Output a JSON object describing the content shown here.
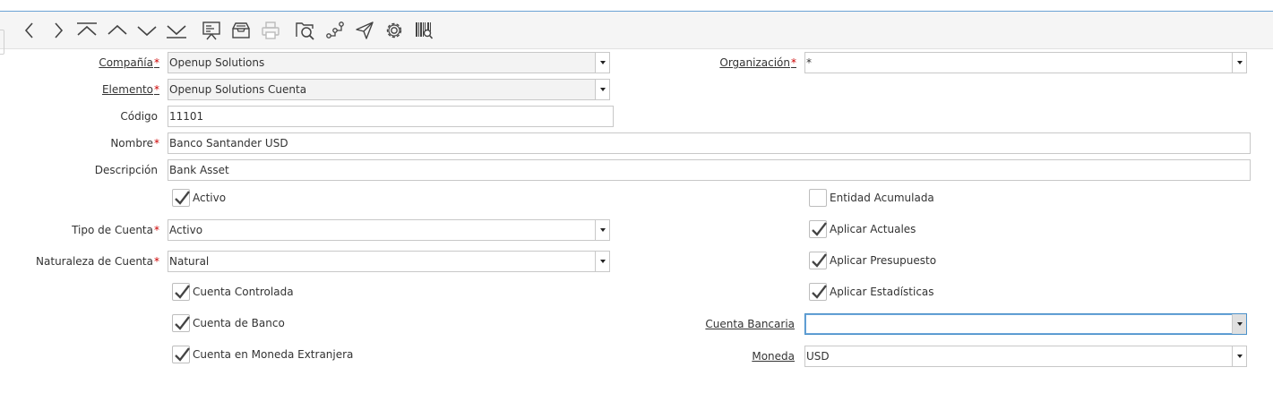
{
  "colors": {
    "accent": "#4a90c8",
    "required": "#cc0000"
  },
  "toolbar": {
    "icons": [
      "previous-icon",
      "next-icon",
      "first-record-icon",
      "up-icon",
      "down-icon",
      "last-record-icon",
      "report-icon",
      "archive-icon",
      "print-icon",
      "zoom-across-icon",
      "workflow-icon",
      "send-icon",
      "settings-icon",
      "barcode-search-icon"
    ]
  },
  "form": {
    "compania": {
      "label": "Compañía",
      "value": "Openup Solutions"
    },
    "organizacion": {
      "label": "Organización",
      "value": "*"
    },
    "elemento": {
      "label": "Elemento",
      "value": "Openup Solutions Cuenta"
    },
    "codigo": {
      "label": "Código",
      "value": "11101"
    },
    "nombre": {
      "label": "Nombre",
      "value": "Banco Santander USD"
    },
    "descripcion": {
      "label": "Descripción",
      "value": "Bank Asset"
    },
    "activo": {
      "label": "Activo",
      "checked": true
    },
    "entidad_acumulada": {
      "label": "Entidad Acumulada",
      "checked": false
    },
    "tipo_cuenta": {
      "label": "Tipo de Cuenta",
      "value": "Activo"
    },
    "aplicar_actuales": {
      "label": "Aplicar Actuales",
      "checked": true
    },
    "naturaleza": {
      "label": "Naturaleza de Cuenta",
      "value": "Natural"
    },
    "aplicar_presupuesto": {
      "label": "Aplicar Presupuesto",
      "checked": true
    },
    "cuenta_controlada": {
      "label": "Cuenta Controlada",
      "checked": true
    },
    "aplicar_estadisticas": {
      "label": "Aplicar Estadísticas",
      "checked": true
    },
    "cuenta_banco": {
      "label": "Cuenta de Banco",
      "checked": true
    },
    "cuenta_bancaria": {
      "label": "Cuenta Bancaria",
      "value": ""
    },
    "moneda_extranjera": {
      "label": "Cuenta en Moneda Extranjera",
      "checked": true
    },
    "moneda": {
      "label": "Moneda",
      "value": "USD"
    }
  }
}
